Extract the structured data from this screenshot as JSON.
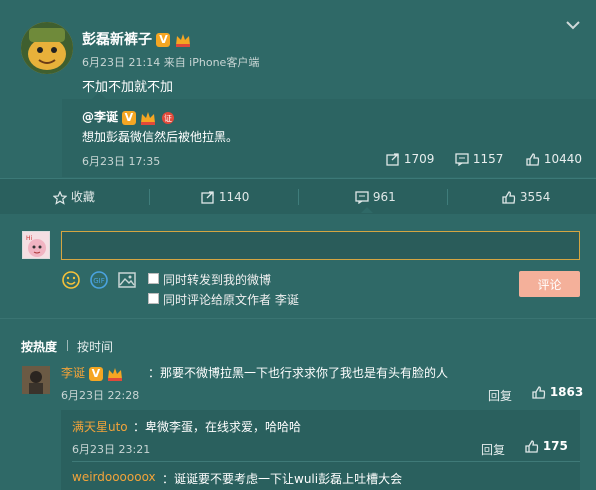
{
  "post": {
    "author": "彭磊新裤子",
    "verified_badge": "V",
    "meta": "6月23日 21:14 来自 iPhone客户端",
    "content": "不加不加就不加",
    "expand_icon": "chevron-down-icon"
  },
  "repost": {
    "author": "@李诞",
    "text": "想加彭磊微信然后被他拉黑。",
    "date": "6月23日 17:35",
    "forwards": "1709",
    "comments": "1157",
    "likes": "10440"
  },
  "actions": {
    "favorite": "收藏",
    "forward": "1140",
    "comment": "961",
    "like": "3554"
  },
  "composer": {
    "input_value": "",
    "also_repost": "同时转发到我的微博",
    "also_comment_original": "同时评论给原文作者 李诞",
    "submit": "评论"
  },
  "sort": {
    "hot": "按热度",
    "time": "按时间"
  },
  "comments": [
    {
      "name": "李诞",
      "text": "：那要不微博拉黑一下也行求求你了我也是有头有脸的人",
      "date": "6月23日 22:28",
      "reply": "回复",
      "likes": "1863"
    }
  ],
  "sub_comments": [
    {
      "name": "满天星uto",
      "text": "：卑微李蛋，在线求爱，哈哈哈",
      "date": "6月23日 23:21",
      "reply": "回复",
      "likes": "175"
    },
    {
      "name": "weirdoooooox",
      "text": "：诞诞要不要考虑一下让wuli彭磊上吐槽大会"
    }
  ],
  "colors": {
    "background": "#2f6967",
    "accent_orange": "#f2a33a",
    "submit_button": "#f4b09a"
  }
}
